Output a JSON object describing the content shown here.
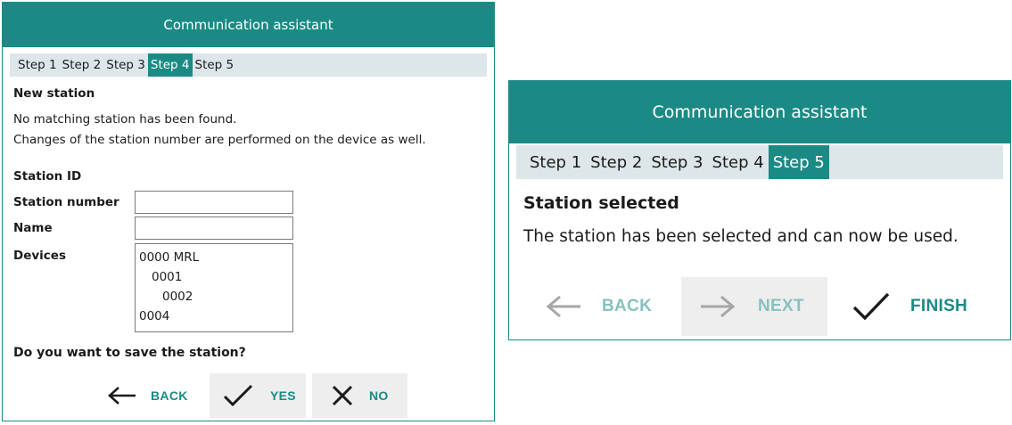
{
  "left_dialog": {
    "title": "Communication assistant",
    "steps": [
      "Step 1",
      "Step 2",
      "Step 3",
      "Step 4",
      "Step 5"
    ],
    "active_step": "Step 4",
    "heading": "New station",
    "message_line1": "No matching station has been found.",
    "message_line2": "Changes of the station number are performed on the device as well.",
    "section_label": "Station ID",
    "station_number_label": "Station number",
    "station_number_value": "",
    "name_label": "Name",
    "name_value": "",
    "devices_label": "Devices",
    "devices": [
      "0000 MRL",
      "0001",
      "0002",
      "0004"
    ],
    "question": "Do you want to save the station?",
    "back_label": "BACK",
    "yes_label": "YES",
    "no_label": "NO"
  },
  "right_dialog": {
    "title": "Communication assistant",
    "steps": [
      "Step 1",
      "Step 2",
      "Step 3",
      "Step 4",
      "Step 5"
    ],
    "active_step": "Step 5",
    "heading": "Station selected",
    "message": "The station has been selected and can now be used.",
    "back_label": "BACK",
    "next_label": "NEXT",
    "finish_label": "FINISH"
  },
  "colors": {
    "accent": "#1b8a85",
    "step_bar": "#dde7ea",
    "button_shade": "#eeeeee",
    "disabled_text": "#86c2bf"
  },
  "icons": {
    "back": "arrow-left-icon",
    "next": "arrow-right-icon",
    "yes": "checkmark-icon",
    "no": "x-icon",
    "finish": "checkmark-icon"
  }
}
